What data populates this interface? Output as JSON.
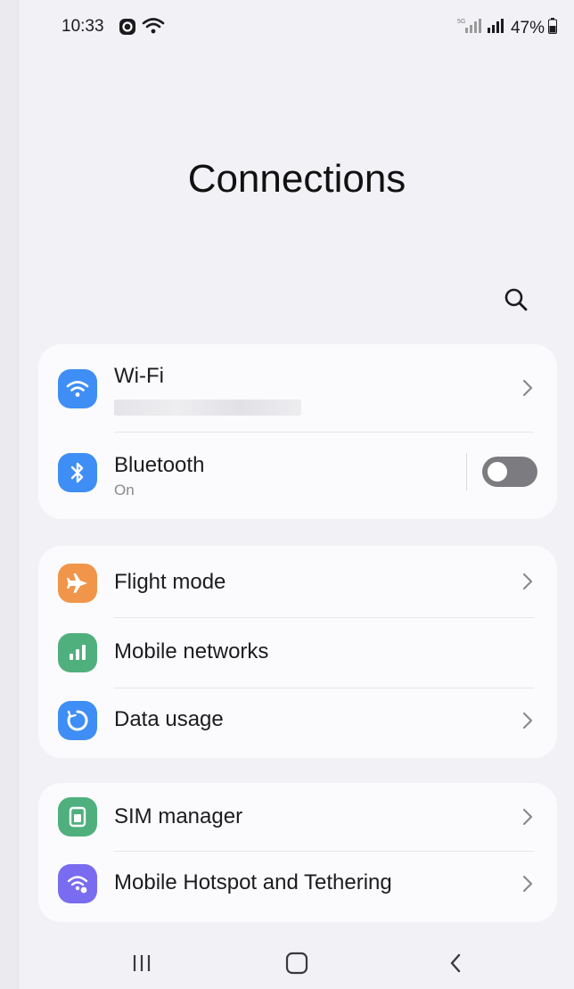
{
  "status_bar": {
    "time": "10:33",
    "battery": "47%"
  },
  "page": {
    "title": "Connections"
  },
  "groups": [
    {
      "items": [
        {
          "label": "Wi-Fi",
          "icon": "wifi-icon",
          "color": "#3f8ef5",
          "sub_blurred": true
        },
        {
          "label": "Bluetooth",
          "sub": "On",
          "icon": "bluetooth-icon",
          "color": "#3f8ef5",
          "toggle_on": false
        }
      ]
    },
    {
      "items": [
        {
          "label": "Flight mode",
          "icon": "airplane-icon",
          "color": "#f0954a"
        },
        {
          "label": "Mobile networks",
          "icon": "signal-bars-icon",
          "color": "#4fb07e"
        },
        {
          "label": "Data usage",
          "icon": "data-usage-icon",
          "color": "#3f8ef5"
        }
      ]
    },
    {
      "items": [
        {
          "label": "SIM manager",
          "icon": "sim-card-icon",
          "color": "#4fb07e"
        },
        {
          "label": "Mobile Hotspot and Tethering",
          "icon": "hotspot-icon",
          "color": "#7a6cf0"
        }
      ]
    }
  ]
}
